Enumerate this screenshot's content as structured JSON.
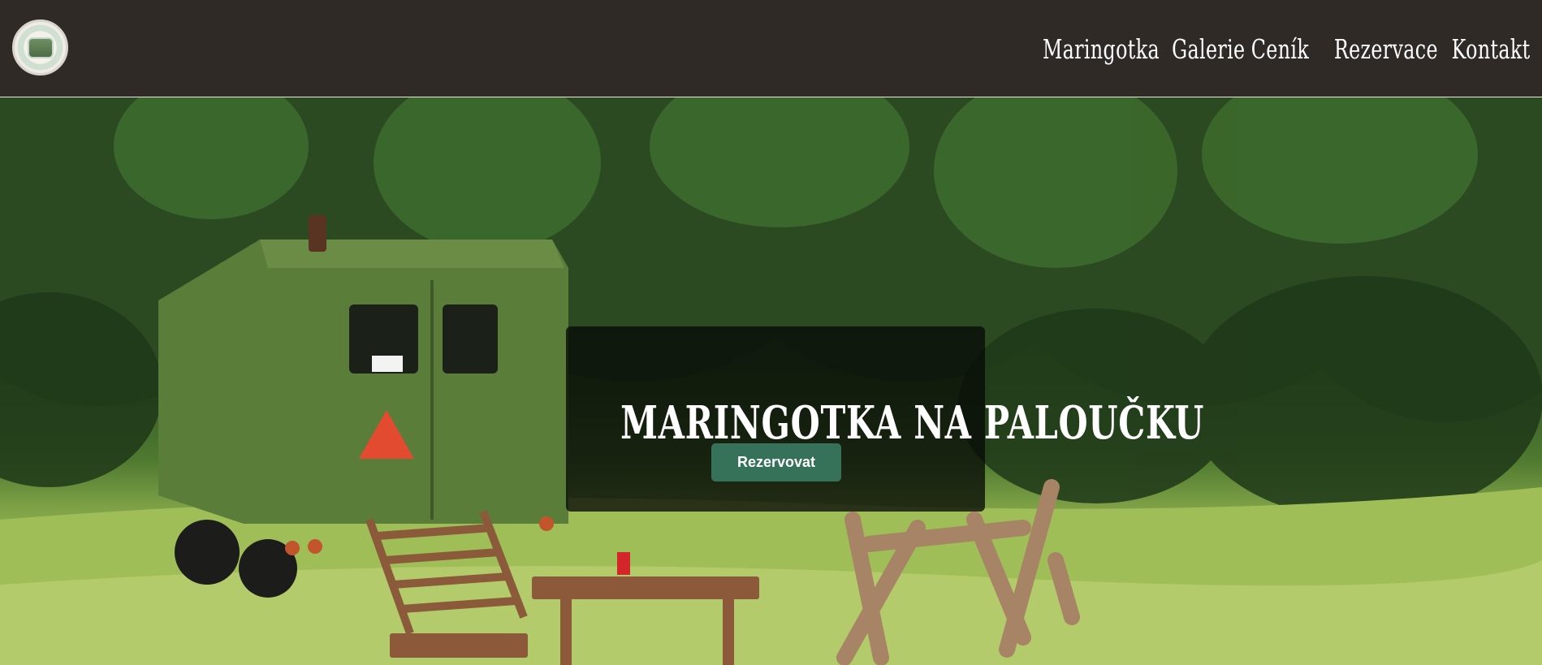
{
  "header": {
    "logo_alt": "Maringotka logo",
    "nav": [
      {
        "label": "Maringotka"
      },
      {
        "label": "Galerie"
      },
      {
        "label": "Ceník"
      },
      {
        "label": "Rezervace"
      },
      {
        "label": "Kontakt"
      }
    ]
  },
  "hero": {
    "title": "MARINGOTKA NA PALOUČKU",
    "cta_label": "Rezervovat"
  },
  "colors": {
    "header_bg": "#2f2a26",
    "cta_bg": "#357259",
    "trailer_green": "#5b7d3a"
  }
}
